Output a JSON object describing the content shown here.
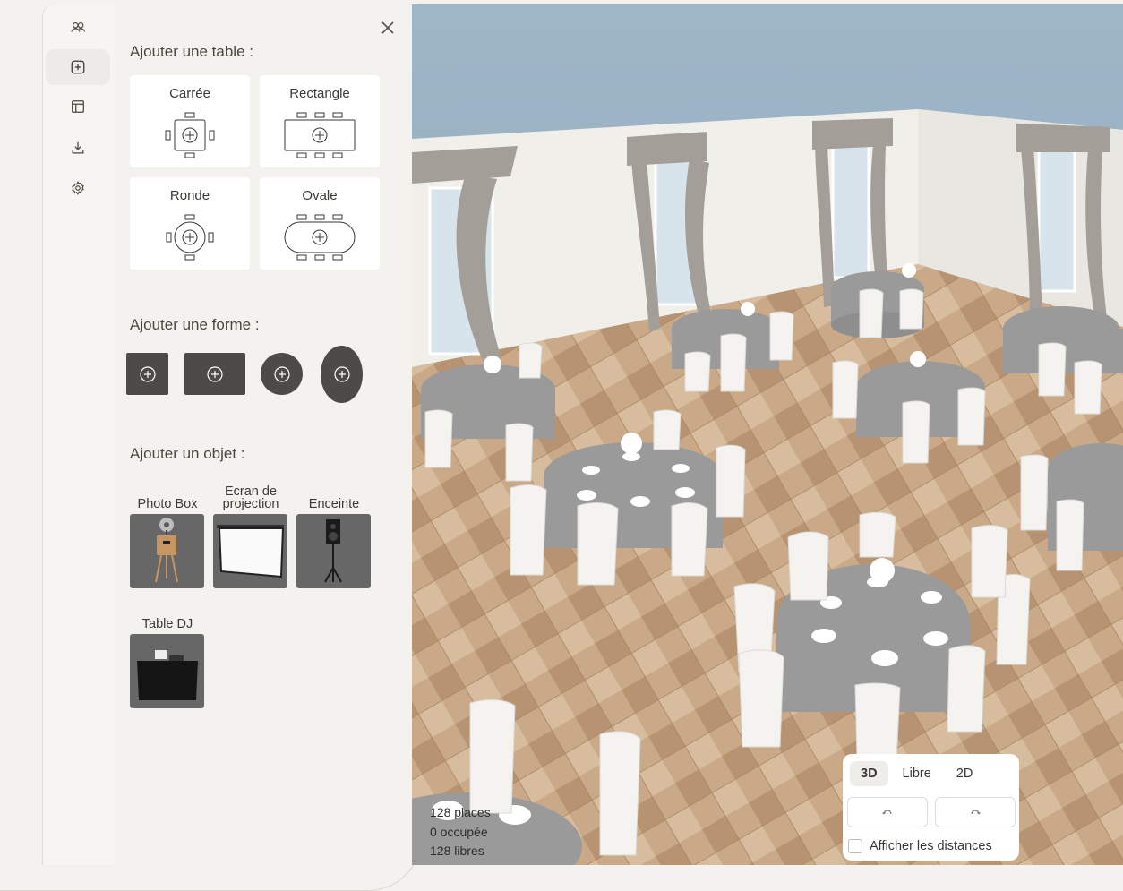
{
  "sidebar": {
    "items": [
      {
        "icon": "users-icon",
        "active": false
      },
      {
        "icon": "add-square-icon",
        "active": true
      },
      {
        "icon": "layout-icon",
        "active": false
      },
      {
        "icon": "download-icon",
        "active": false
      },
      {
        "icon": "gear-icon",
        "active": false
      }
    ]
  },
  "panel": {
    "close_icon": "close-icon",
    "tables_heading": "Ajouter une table :",
    "tables": [
      {
        "label": "Carrée",
        "icon": "square-table-icon"
      },
      {
        "label": "Rectangle",
        "icon": "rectangle-table-icon"
      },
      {
        "label": "Ronde",
        "icon": "round-table-icon"
      },
      {
        "label": "Ovale",
        "icon": "oval-table-icon"
      }
    ],
    "shapes_heading": "Ajouter une forme :",
    "shapes": [
      {
        "name": "square-shape",
        "icon": "plus-circle-icon"
      },
      {
        "name": "rectangle-shape",
        "icon": "plus-circle-icon"
      },
      {
        "name": "circle-shape",
        "icon": "plus-circle-icon"
      },
      {
        "name": "oval-shape",
        "icon": "plus-circle-icon"
      }
    ],
    "objects_heading": "Ajouter un objet :",
    "objects": [
      {
        "label": "Photo Box"
      },
      {
        "label": "Ecran de projection"
      },
      {
        "label": "Enceinte"
      },
      {
        "label": "Table DJ"
      }
    ]
  },
  "scene": {
    "stats": {
      "places": "128 places",
      "occupied": "0 occupée",
      "free": "128 libres"
    },
    "view_modes": [
      "3D",
      "Libre",
      "2D"
    ],
    "active_mode": "3D",
    "rotate_left_icon": "rotate-left-icon",
    "rotate_right_icon": "rotate-right-icon",
    "show_distances_label": "Afficher les distances",
    "show_distances_checked": false,
    "colors": {
      "wall": "#f4f2ee",
      "sky": "#9db3c4",
      "floor": "#c8a886",
      "tablecloth": "#9a9a9a",
      "chair": "#f4f3f0"
    }
  }
}
